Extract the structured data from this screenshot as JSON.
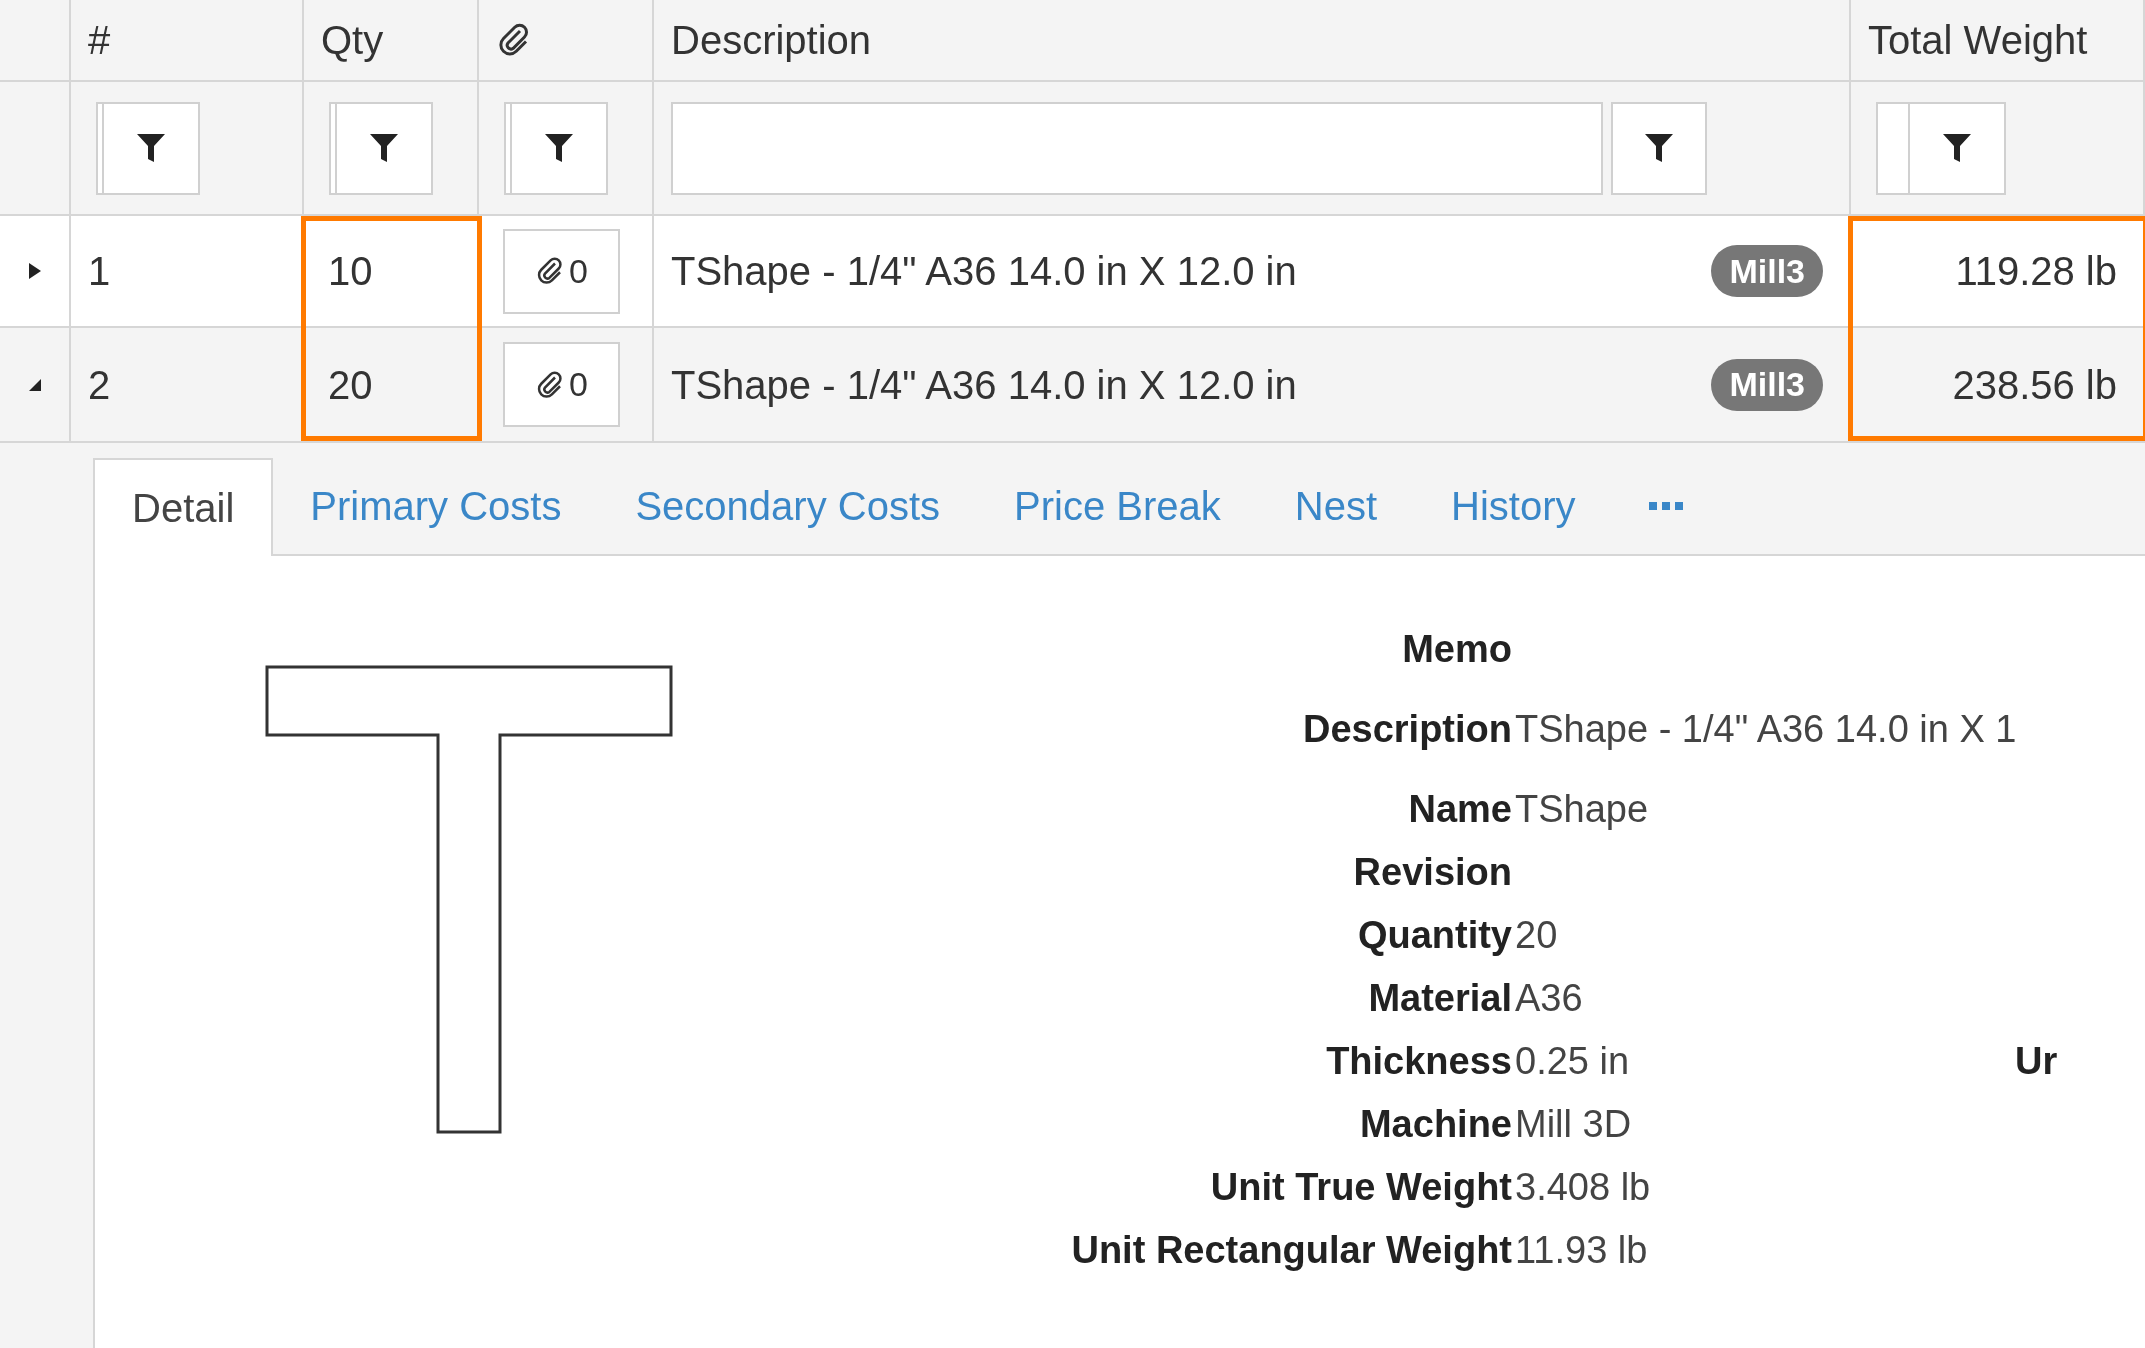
{
  "columns": [
    {
      "kind": "expander",
      "highlighted": false
    },
    {
      "kind": "text",
      "label": "#",
      "highlighted": false
    },
    {
      "kind": "text",
      "label": "Qty",
      "highlighted": true
    },
    {
      "kind": "attachments",
      "highlighted": false
    },
    {
      "kind": "wide",
      "label": "Description",
      "highlighted": false
    },
    {
      "kind": "text",
      "label": "Total Weight",
      "highlighted": true
    }
  ],
  "rows": [
    {
      "expanded": false,
      "number": "1",
      "qty": "10",
      "attachments": "0",
      "description": "TShape - 1/4\" A36 14.0 in X 12.0 in",
      "tag": "Mill3",
      "total_weight": "119.28 lb"
    },
    {
      "expanded": true,
      "number": "2",
      "qty": "20",
      "attachments": "0",
      "description": "TShape - 1/4\" A36 14.0 in X 12.0 in",
      "tag": "Mill3",
      "total_weight": "238.56 lb"
    }
  ],
  "tabs": [
    {
      "label": "Detail",
      "selected": true
    },
    {
      "label": "Primary Costs",
      "selected": false
    },
    {
      "label": "Secondary Costs",
      "selected": false
    },
    {
      "label": "Price Break",
      "selected": false
    },
    {
      "label": "Nest",
      "selected": false
    },
    {
      "label": "History",
      "selected": false
    },
    {
      "kind": "more",
      "selected": false
    }
  ],
  "detail": {
    "fields": [
      {
        "label": "Memo"
      },
      {
        "label": "Description",
        "value": "TShape - 1/4\" A36 14.0 in X 1"
      },
      {
        "label": "Name",
        "value": "TShape"
      },
      {
        "label": "Revision"
      },
      {
        "label": "Quantity",
        "value": "20"
      },
      {
        "label": "Material",
        "value": "A36"
      },
      {
        "label": "Thickness",
        "value": "0.25 in",
        "aside": "Ur"
      },
      {
        "label": "Machine",
        "value": "Mill 3D"
      },
      {
        "label": "Unit True Weight",
        "value": "3.408 lb"
      },
      {
        "label": "Unit Rectangular Weight",
        "value": "11.93 lb"
      }
    ]
  }
}
